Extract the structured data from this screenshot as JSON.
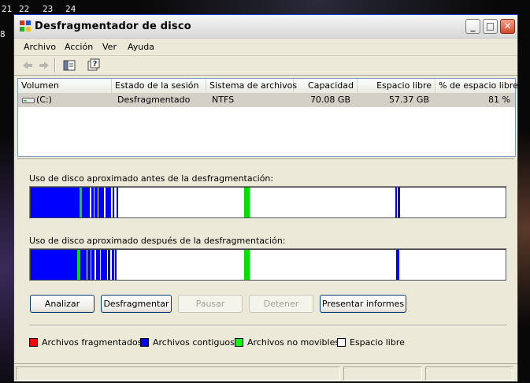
{
  "desktop": {
    "calendar": [
      "21",
      "22",
      "23",
      "24",
      "8"
    ]
  },
  "window": {
    "title": "Desfragmentador de disco",
    "controls": {
      "minimize": "_",
      "maximize": "□",
      "close": "✕"
    }
  },
  "menu": [
    "Archivo",
    "Acción",
    "Ver",
    "Ayuda"
  ],
  "toolbar": {
    "icons": [
      "back-arrow-icon",
      "forward-arrow-icon",
      "show-hide-console-tree-icon",
      "help-icon"
    ]
  },
  "volumes": {
    "columns": [
      "Volumen",
      "Estado de la sesión",
      "Sistema de archivos",
      "Capacidad",
      "Espacio libre",
      "% de espacio libre"
    ],
    "rows": [
      {
        "volume": "(C:)",
        "status": "Desfragmentado",
        "filesystem": "NTFS",
        "capacity": "70.08 GB",
        "free": "57.37 GB",
        "percent_free": "81 %"
      }
    ]
  },
  "before": {
    "caption": "Uso de disco aproximado antes de la desfragmentación:",
    "fragments": [
      {
        "from": 0.0,
        "to": 0.102,
        "kind": "contiguous"
      },
      {
        "from": 0.102,
        "to": 0.108,
        "kind": "unmovable"
      },
      {
        "from": 0.108,
        "to": 0.125,
        "kind": "contiguous"
      },
      {
        "from": 0.127,
        "to": 0.132,
        "kind": "contiguous"
      },
      {
        "from": 0.134,
        "to": 0.14,
        "kind": "contiguous"
      },
      {
        "from": 0.142,
        "to": 0.148,
        "kind": "contiguous"
      },
      {
        "from": 0.15,
        "to": 0.155,
        "kind": "contiguous"
      },
      {
        "from": 0.157,
        "to": 0.163,
        "kind": "contiguous"
      },
      {
        "from": 0.165,
        "to": 0.17,
        "kind": "contiguous"
      },
      {
        "from": 0.172,
        "to": 0.176,
        "kind": "contiguous"
      },
      {
        "from": 0.18,
        "to": 0.184,
        "kind": "contiguous"
      },
      {
        "from": 0.45,
        "to": 0.461,
        "kind": "unmovable"
      },
      {
        "from": 0.767,
        "to": 0.771,
        "kind": "contiguous"
      },
      {
        "from": 0.773,
        "to": 0.778,
        "kind": "contiguous"
      }
    ]
  },
  "after": {
    "caption": "Uso de disco aproximado después de la desfragmentación:",
    "fragments": [
      {
        "from": 0.0,
        "to": 0.098,
        "kind": "contiguous"
      },
      {
        "from": 0.098,
        "to": 0.104,
        "kind": "unmovable"
      },
      {
        "from": 0.104,
        "to": 0.118,
        "kind": "contiguous"
      },
      {
        "from": 0.12,
        "to": 0.126,
        "kind": "contiguous"
      },
      {
        "from": 0.128,
        "to": 0.135,
        "kind": "contiguous"
      },
      {
        "from": 0.137,
        "to": 0.145,
        "kind": "contiguous"
      },
      {
        "from": 0.147,
        "to": 0.153,
        "kind": "contiguous"
      },
      {
        "from": 0.155,
        "to": 0.161,
        "kind": "contiguous"
      },
      {
        "from": 0.163,
        "to": 0.168,
        "kind": "contiguous"
      },
      {
        "from": 0.17,
        "to": 0.175,
        "kind": "contiguous"
      },
      {
        "from": 0.177,
        "to": 0.181,
        "kind": "contiguous"
      },
      {
        "from": 0.45,
        "to": 0.461,
        "kind": "unmovable"
      },
      {
        "from": 0.77,
        "to": 0.777,
        "kind": "contiguous"
      }
    ]
  },
  "buttons": {
    "analyze": "Analizar",
    "defrag": "Desfragmentar",
    "pause": "Pausar",
    "stop": "Detener",
    "report": "Presentar informes"
  },
  "legend": [
    {
      "label": "Archivos fragmentados",
      "color": "#ff0000"
    },
    {
      "label": "Archivos contiguos",
      "color": "#0000ff"
    },
    {
      "label": "Archivos no movibles",
      "color": "#00ff00"
    },
    {
      "label": "Espacio libre",
      "color": "#ffffff"
    }
  ],
  "colors": {
    "fragmented": "#ff0000",
    "contiguous": "#0000ff",
    "unmovable": "#00e000",
    "free": "#ffffff"
  }
}
